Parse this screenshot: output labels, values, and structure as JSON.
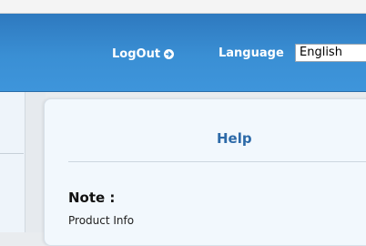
{
  "header": {
    "logout_label": "LogOut",
    "logout_icon": "arrow-circle-right-icon",
    "language_label": "Language",
    "language_value": "English"
  },
  "help_panel": {
    "title": "Help",
    "note_heading": "Note :",
    "product_info": "Product Info"
  },
  "colors": {
    "header_blue": "#3a8fd4",
    "title_blue": "#2d6aa8",
    "panel_bg": "#f2f8fd"
  }
}
